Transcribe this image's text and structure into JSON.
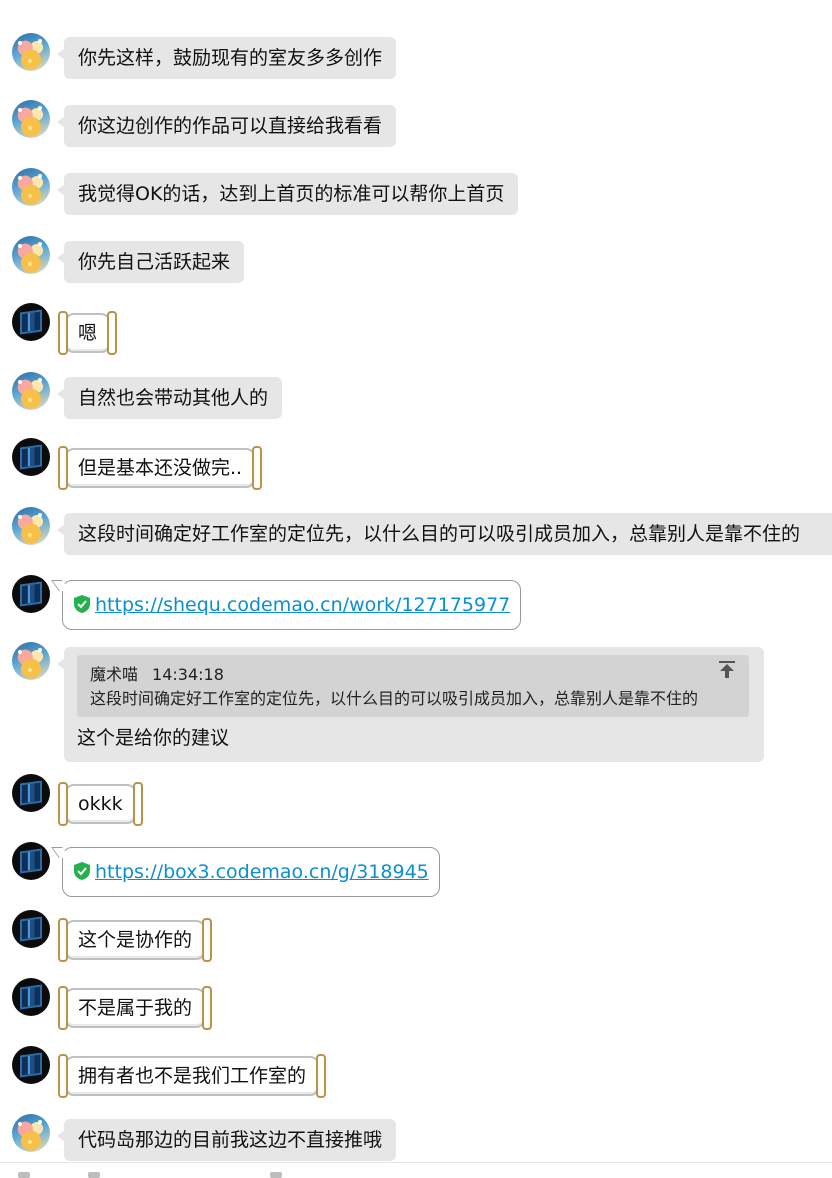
{
  "messages": [
    {
      "type": "text",
      "sender": "other",
      "avatar": "cat-avatar",
      "text": "你先这样，鼓励现有的室友多多创作"
    },
    {
      "type": "text",
      "sender": "other",
      "avatar": "cat-avatar",
      "text": "你这边创作的作品可以直接给我看看"
    },
    {
      "type": "text",
      "sender": "other",
      "avatar": "cat-avatar",
      "text": "我觉得OK的话，达到上首页的标准可以帮你上首页"
    },
    {
      "type": "text",
      "sender": "other",
      "avatar": "cat-avatar",
      "text": "你先自己活跃起来"
    },
    {
      "type": "text",
      "sender": "self",
      "avatar": "cube-avatar",
      "text": "嗯"
    },
    {
      "type": "text",
      "sender": "other",
      "avatar": "cat-avatar",
      "text": "自然也会带动其他人的"
    },
    {
      "type": "text",
      "sender": "self",
      "avatar": "cube-avatar",
      "text": "但是基本还没做完.."
    },
    {
      "type": "text",
      "sender": "other",
      "avatar": "cat-avatar",
      "text": "这段时间确定好工作室的定位先，以什么目的可以吸引成员加入，总靠别人是靠不住的"
    },
    {
      "type": "link",
      "sender": "self",
      "avatar": "cube-avatar",
      "url": "https://shequ.codemao.cn/work/127175977"
    },
    {
      "type": "quote",
      "sender": "other",
      "avatar": "cat-avatar",
      "quote_author": "魔术喵",
      "quote_time": "14:34:18",
      "quote_text": "这段时间确定好工作室的定位先，以什么目的可以吸引成员加入，总靠别人是靠不住的",
      "text": "这个是给你的建议"
    },
    {
      "type": "text",
      "sender": "self",
      "avatar": "cube-avatar",
      "text": "okkk"
    },
    {
      "type": "link",
      "sender": "self",
      "avatar": "cube-avatar",
      "url": "https://box3.codemao.cn/g/318945"
    },
    {
      "type": "text",
      "sender": "self",
      "avatar": "cube-avatar",
      "text": "这个是协作的"
    },
    {
      "type": "text",
      "sender": "self",
      "avatar": "cube-avatar",
      "text": "不是属于我的"
    },
    {
      "type": "text",
      "sender": "self",
      "avatar": "cube-avatar",
      "text": "拥有者也不是我们工作室的"
    },
    {
      "type": "text",
      "sender": "other",
      "avatar": "cat-avatar",
      "text": "代码岛那边的目前我这边不直接推哦"
    }
  ],
  "colors": {
    "bubble_gray": "#e6e6e6",
    "link_blue": "#0b8fd0",
    "frame_gold": "#b89248",
    "shield_green": "#22b14c"
  }
}
